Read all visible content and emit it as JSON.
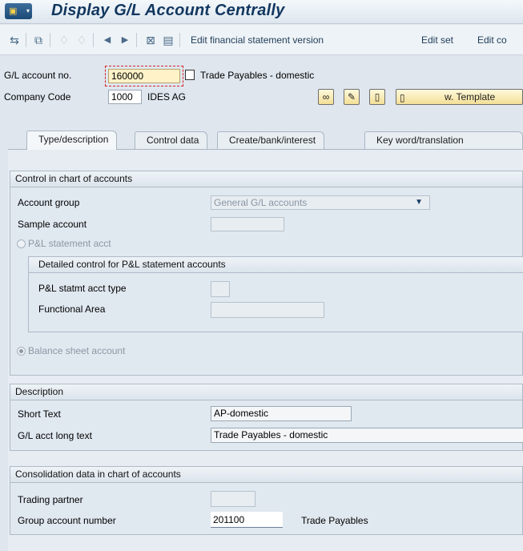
{
  "title": "Display G/L Account Centrally",
  "toolbar": {
    "edit_fs_version": "Edit financial statement version",
    "edit_set": "Edit set",
    "edit_co": "Edit co"
  },
  "header": {
    "gl_account_label": "G/L account no.",
    "gl_account_value": "160000",
    "gl_account_desc": "Trade Payables - domestic",
    "company_code_label": "Company Code",
    "company_code_value": "1000",
    "company_name": "IDES AG",
    "template_button": "w. Template"
  },
  "tabs": [
    {
      "label": "Type/description",
      "active": true
    },
    {
      "label": "Control data",
      "active": false
    },
    {
      "label": "Create/bank/interest",
      "active": false
    },
    {
      "label": "Key word/translation",
      "active": false
    }
  ],
  "control_group": {
    "title": "Control in chart of accounts",
    "account_group_label": "Account group",
    "account_group_value": "General G/L accounts",
    "sample_account_label": "Sample account",
    "sample_account_value": "",
    "pl_radio_label": "P&L statement acct",
    "detail_title": "Detailed control for P&L statement accounts",
    "pl_type_label": "P&L statmt acct type",
    "functional_area_label": "Functional Area",
    "balance_radio_label": "Balance sheet account"
  },
  "description_group": {
    "title": "Description",
    "short_text_label": "Short Text",
    "short_text_value": "AP-domestic",
    "long_text_label": "G/L acct long text",
    "long_text_value": "Trade Payables - domestic"
  },
  "consolidation_group": {
    "title": "Consolidation data in chart of accounts",
    "trading_partner_label": "Trading partner",
    "trading_partner_value": "",
    "group_account_label": "Group account number",
    "group_account_value": "201100",
    "group_account_desc": "Trade Payables"
  }
}
